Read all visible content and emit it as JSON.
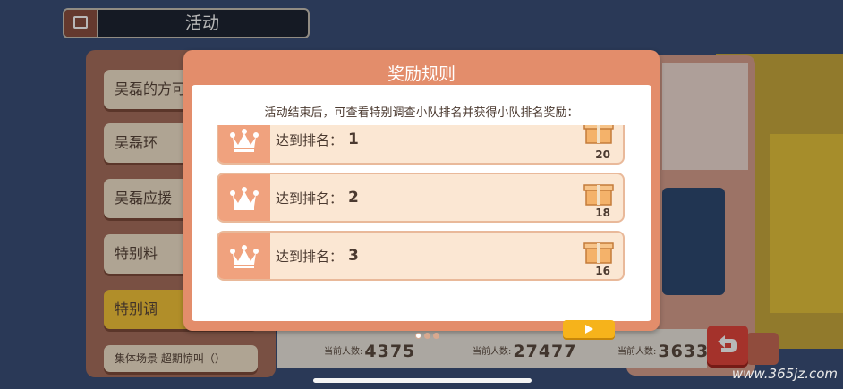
{
  "topbar": {
    "title": "活动",
    "icon": "book-icon"
  },
  "left_tabs": [
    {
      "label": "吴磊的方可",
      "active": false
    },
    {
      "label": "吴磊环",
      "active": false
    },
    {
      "label": "吴磊应援",
      "active": false
    },
    {
      "label": "特别料",
      "active": false
    },
    {
      "label": "特别调",
      "active": true
    },
    {
      "label": "集体场景 超期惊叫（）",
      "active": false
    }
  ],
  "counts": [
    {
      "label": "当前人数:",
      "value": "4375"
    },
    {
      "label": "当前人数:",
      "value": "27477"
    },
    {
      "label": "当前人数:",
      "value": "3633"
    }
  ],
  "modal": {
    "title": "奖励规则",
    "description": "活动结束后，可查看特别调查小队排名并获得小队排名奖励：",
    "rows": [
      {
        "label": "达到排名：",
        "rank": "1",
        "reward_count": "20"
      },
      {
        "label": "达到排名：",
        "rank": "2",
        "reward_count": "18"
      },
      {
        "label": "达到排名：",
        "rank": "3",
        "reward_count": "16"
      }
    ],
    "pagination": {
      "pages": 3,
      "current": 1
    }
  },
  "watermark": "www.365jz.com",
  "colors": {
    "modal": "#e38d6b",
    "accent": "#f6b31b",
    "back": "#e4463c"
  }
}
